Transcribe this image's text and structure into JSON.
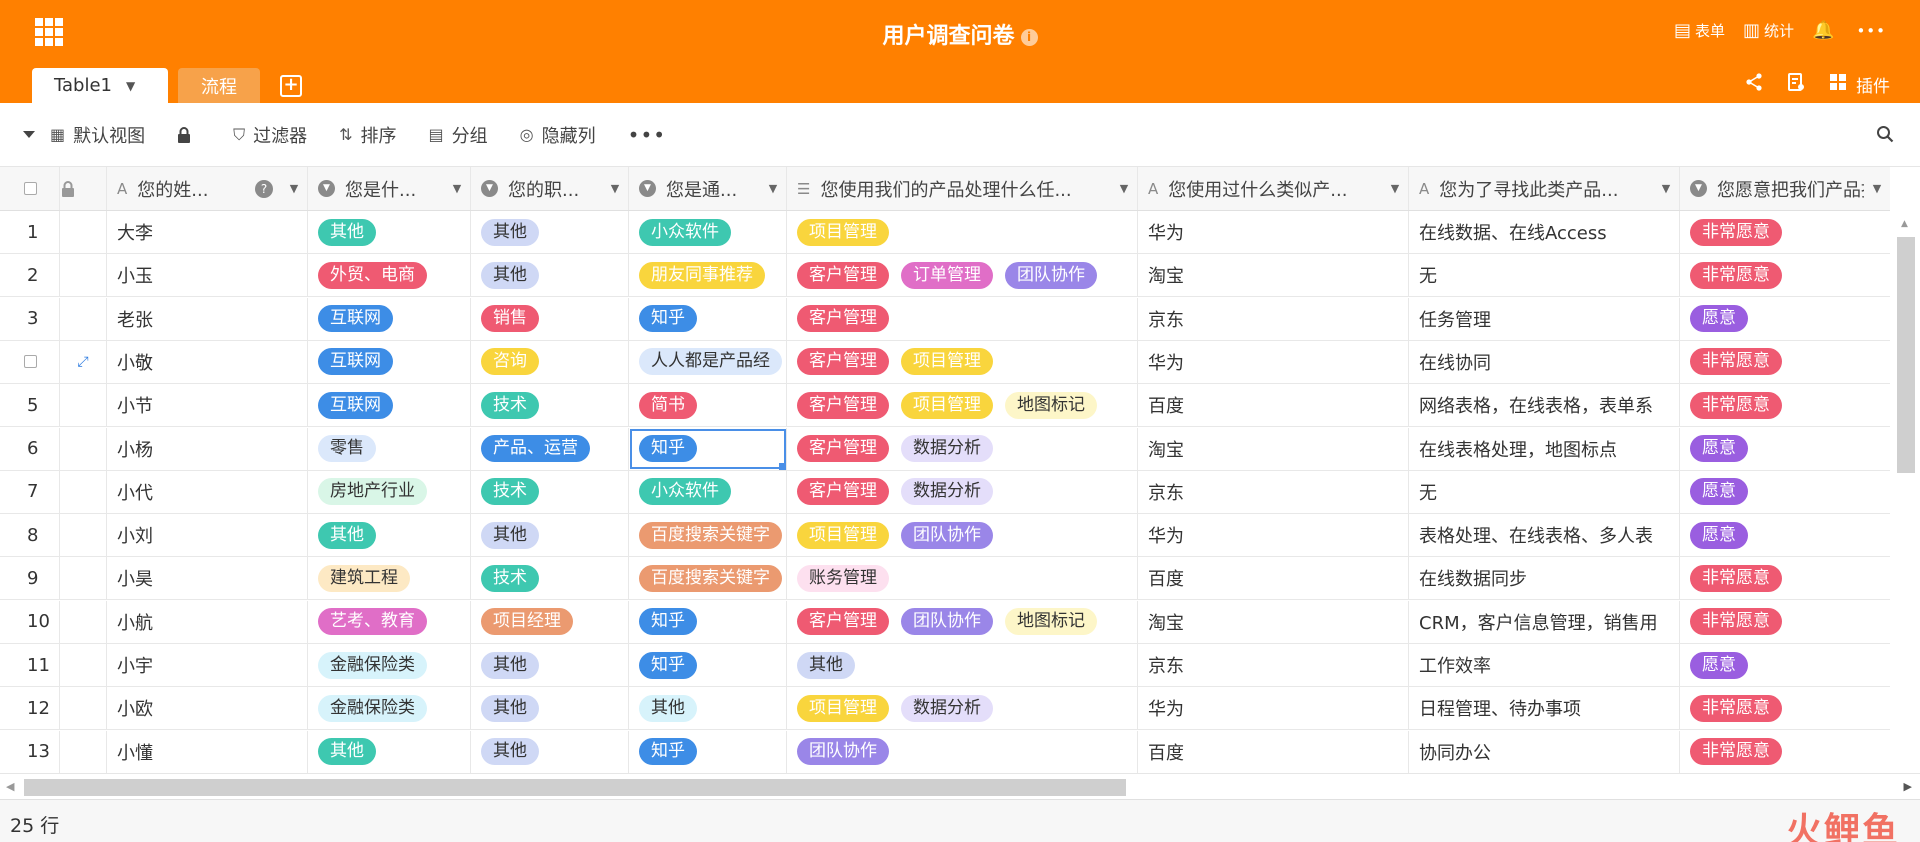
{
  "header": {
    "title": "用户调查问卷",
    "actions": [
      {
        "icon": "form-icon",
        "glyph": "▤",
        "label": "表单"
      },
      {
        "icon": "stats-icon",
        "glyph": "▥",
        "label": "统计"
      },
      {
        "icon": "bell-icon",
        "glyph": "🔔",
        "label": ""
      },
      {
        "icon": "more-icon",
        "glyph": "•••",
        "label": ""
      }
    ]
  },
  "tabs": [
    {
      "label": "Table1",
      "active": true
    },
    {
      "label": "流程",
      "active": false
    }
  ],
  "tabs_right": {
    "plugins_label": "插件"
  },
  "toolbar": {
    "view_label": "默认视图",
    "filter_label": "过滤器",
    "sort_label": "排序",
    "group_label": "分组",
    "hide_label": "隐藏列"
  },
  "columns": [
    {
      "label": "您的姓...",
      "type": "text"
    },
    {
      "label": "您是什...",
      "type": "select"
    },
    {
      "label": "您的职...",
      "type": "select"
    },
    {
      "label": "您是通...",
      "type": "select"
    },
    {
      "label": "您使用我们的产品处理什么任...",
      "type": "multi"
    },
    {
      "label": "您使用过什么类似产...",
      "type": "text"
    },
    {
      "label": "您为了寻找此类产品...",
      "type": "text"
    },
    {
      "label": "您愿意把我们产品推...",
      "type": "select"
    }
  ],
  "colors": {
    "brand": "#ff8000",
    "selection": "#4a8fe7"
  },
  "rows": [
    {
      "n": "1",
      "name": "大李",
      "industry": {
        "t": "其他",
        "c": "#3ec8b0",
        "fg": "#fff"
      },
      "job": {
        "t": "其他",
        "c": "#cfd8f5",
        "fg": "#333"
      },
      "source": {
        "t": "小众软件",
        "c": "#3ec8b0",
        "fg": "#fff"
      },
      "tasks": [
        {
          "t": "项目管理",
          "c": "#f9d53d",
          "fg": "#fff"
        }
      ],
      "similar": "华为",
      "search": "在线数据、在线Access",
      "recommend": {
        "t": "非常愿意",
        "c": "#ef5a72",
        "fg": "#fff"
      }
    },
    {
      "n": "2",
      "name": "小玉",
      "industry": {
        "t": "外贸、电商",
        "c": "#ef5a72",
        "fg": "#fff"
      },
      "job": {
        "t": "其他",
        "c": "#cfd8f5",
        "fg": "#333"
      },
      "source": {
        "t": "朋友同事推荐",
        "c": "#f9d53d",
        "fg": "#fff"
      },
      "tasks": [
        {
          "t": "客户管理",
          "c": "#ef5a72",
          "fg": "#fff"
        },
        {
          "t": "订单管理",
          "c": "#e06ec7",
          "fg": "#fff"
        },
        {
          "t": "团队协作",
          "c": "#9a86e8",
          "fg": "#fff"
        }
      ],
      "similar": "淘宝",
      "search": "无",
      "recommend": {
        "t": "非常愿意",
        "c": "#ef5a72",
        "fg": "#fff"
      }
    },
    {
      "n": "3",
      "name": "老张",
      "industry": {
        "t": "互联网",
        "c": "#3d8de6",
        "fg": "#fff"
      },
      "job": {
        "t": "销售",
        "c": "#ef5a72",
        "fg": "#fff"
      },
      "source": {
        "t": "知乎",
        "c": "#3d8de6",
        "fg": "#fff"
      },
      "tasks": [
        {
          "t": "客户管理",
          "c": "#ef5a72",
          "fg": "#fff"
        }
      ],
      "similar": "京东",
      "search": "任务管理",
      "recommend": {
        "t": "愿意",
        "c": "#9a5ee0",
        "fg": "#fff"
      }
    },
    {
      "n": "4",
      "name": "小敬",
      "industry": {
        "t": "互联网",
        "c": "#3d8de6",
        "fg": "#fff"
      },
      "job": {
        "t": "咨询",
        "c": "#f9d53d",
        "fg": "#fff"
      },
      "source": {
        "t": "人人都是产品经",
        "c": "#dbe8fb",
        "fg": "#333"
      },
      "tasks": [
        {
          "t": "客户管理",
          "c": "#ef5a72",
          "fg": "#fff"
        },
        {
          "t": "项目管理",
          "c": "#f9d53d",
          "fg": "#fff"
        }
      ],
      "similar": "华为",
      "search": "在线协同",
      "recommend": {
        "t": "非常愿意",
        "c": "#ef5a72",
        "fg": "#fff"
      }
    },
    {
      "n": "5",
      "name": "小节",
      "industry": {
        "t": "互联网",
        "c": "#3d8de6",
        "fg": "#fff"
      },
      "job": {
        "t": "技术",
        "c": "#3ec8b0",
        "fg": "#fff"
      },
      "source": {
        "t": "简书",
        "c": "#ef5a72",
        "fg": "#fff"
      },
      "tasks": [
        {
          "t": "客户管理",
          "c": "#ef5a72",
          "fg": "#fff"
        },
        {
          "t": "项目管理",
          "c": "#f9d53d",
          "fg": "#fff"
        },
        {
          "t": "地图标记",
          "c": "#fdf6c8",
          "fg": "#333"
        }
      ],
      "similar": "百度",
      "search": "网络表格，在线表格，表单系",
      "recommend": {
        "t": "非常愿意",
        "c": "#ef5a72",
        "fg": "#fff"
      }
    },
    {
      "n": "6",
      "name": "小杨",
      "industry": {
        "t": "零售",
        "c": "#dbe8fb",
        "fg": "#333"
      },
      "job": {
        "t": "产品、运营",
        "c": "#3d8de6",
        "fg": "#fff"
      },
      "source": {
        "t": "知乎",
        "c": "#3d8de6",
        "fg": "#fff"
      },
      "tasks": [
        {
          "t": "客户管理",
          "c": "#ef5a72",
          "fg": "#fff"
        },
        {
          "t": "数据分析",
          "c": "#e4defa",
          "fg": "#333"
        }
      ],
      "similar": "淘宝",
      "search": "在线表格处理，地图标点",
      "recommend": {
        "t": "愿意",
        "c": "#9a5ee0",
        "fg": "#fff"
      }
    },
    {
      "n": "7",
      "name": "小代",
      "industry": {
        "t": "房地产行业",
        "c": "#d9f6e7",
        "fg": "#333"
      },
      "job": {
        "t": "技术",
        "c": "#3ec8b0",
        "fg": "#fff"
      },
      "source": {
        "t": "小众软件",
        "c": "#3ec8b0",
        "fg": "#fff"
      },
      "tasks": [
        {
          "t": "客户管理",
          "c": "#ef5a72",
          "fg": "#fff"
        },
        {
          "t": "数据分析",
          "c": "#e4defa",
          "fg": "#333"
        }
      ],
      "similar": "京东",
      "search": "无",
      "recommend": {
        "t": "愿意",
        "c": "#9a5ee0",
        "fg": "#fff"
      }
    },
    {
      "n": "8",
      "name": "小刘",
      "industry": {
        "t": "其他",
        "c": "#3ec8b0",
        "fg": "#fff"
      },
      "job": {
        "t": "其他",
        "c": "#cfd8f5",
        "fg": "#333"
      },
      "source": {
        "t": "百度搜索关键字",
        "c": "#eb9a70",
        "fg": "#fff"
      },
      "tasks": [
        {
          "t": "项目管理",
          "c": "#f9d53d",
          "fg": "#fff"
        },
        {
          "t": "团队协作",
          "c": "#9a86e8",
          "fg": "#fff"
        }
      ],
      "similar": "华为",
      "search": "表格处理、在线表格、多人表",
      "recommend": {
        "t": "愿意",
        "c": "#9a5ee0",
        "fg": "#fff"
      }
    },
    {
      "n": "9",
      "name": "小昊",
      "industry": {
        "t": "建筑工程",
        "c": "#fde9c4",
        "fg": "#333"
      },
      "job": {
        "t": "技术",
        "c": "#3ec8b0",
        "fg": "#fff"
      },
      "source": {
        "t": "百度搜索关键字",
        "c": "#eb9a70",
        "fg": "#fff"
      },
      "tasks": [
        {
          "t": "账务管理",
          "c": "#fde0ef",
          "fg": "#333"
        }
      ],
      "similar": "百度",
      "search": "在线数据同步",
      "recommend": {
        "t": "非常愿意",
        "c": "#ef5a72",
        "fg": "#fff"
      }
    },
    {
      "n": "10",
      "name": "小航",
      "industry": {
        "t": "艺考、教育",
        "c": "#e06ec7",
        "fg": "#fff"
      },
      "job": {
        "t": "项目经理",
        "c": "#eb9a70",
        "fg": "#fff"
      },
      "source": {
        "t": "知乎",
        "c": "#3d8de6",
        "fg": "#fff"
      },
      "tasks": [
        {
          "t": "客户管理",
          "c": "#ef5a72",
          "fg": "#fff"
        },
        {
          "t": "团队协作",
          "c": "#9a86e8",
          "fg": "#fff"
        },
        {
          "t": "地图标记",
          "c": "#fdf6c8",
          "fg": "#333"
        }
      ],
      "similar": "淘宝",
      "search": "CRM，客户信息管理，销售用",
      "recommend": {
        "t": "非常愿意",
        "c": "#ef5a72",
        "fg": "#fff"
      }
    },
    {
      "n": "11",
      "name": "小宇",
      "industry": {
        "t": "金融保险类",
        "c": "#d7f3fb",
        "fg": "#333"
      },
      "job": {
        "t": "其他",
        "c": "#cfd8f5",
        "fg": "#333"
      },
      "source": {
        "t": "知乎",
        "c": "#3d8de6",
        "fg": "#fff"
      },
      "tasks": [
        {
          "t": "其他",
          "c": "#cfd8f5",
          "fg": "#333"
        }
      ],
      "similar": "京东",
      "search": "工作效率",
      "recommend": {
        "t": "愿意",
        "c": "#9a5ee0",
        "fg": "#fff"
      }
    },
    {
      "n": "12",
      "name": "小欧",
      "industry": {
        "t": "金融保险类",
        "c": "#d7f3fb",
        "fg": "#333"
      },
      "job": {
        "t": "其他",
        "c": "#cfd8f5",
        "fg": "#333"
      },
      "source": {
        "t": "其他",
        "c": "#d7f3fb",
        "fg": "#333"
      },
      "tasks": [
        {
          "t": "项目管理",
          "c": "#f9d53d",
          "fg": "#fff"
        },
        {
          "t": "数据分析",
          "c": "#e4defa",
          "fg": "#333"
        }
      ],
      "similar": "华为",
      "search": "日程管理、待办事项",
      "recommend": {
        "t": "非常愿意",
        "c": "#ef5a72",
        "fg": "#fff"
      }
    },
    {
      "n": "13",
      "name": "小懂",
      "industry": {
        "t": "其他",
        "c": "#3ec8b0",
        "fg": "#fff"
      },
      "job": {
        "t": "其他",
        "c": "#cfd8f5",
        "fg": "#333"
      },
      "source": {
        "t": "知乎",
        "c": "#3d8de6",
        "fg": "#fff"
      },
      "tasks": [
        {
          "t": "团队协作",
          "c": "#9a86e8",
          "fg": "#fff"
        }
      ],
      "similar": "百度",
      "search": "协同办公",
      "recommend": {
        "t": "非常愿意",
        "c": "#ef5a72",
        "fg": "#fff"
      }
    }
  ],
  "footer": {
    "row_count": "25 行",
    "watermark": "火鲤鱼"
  }
}
